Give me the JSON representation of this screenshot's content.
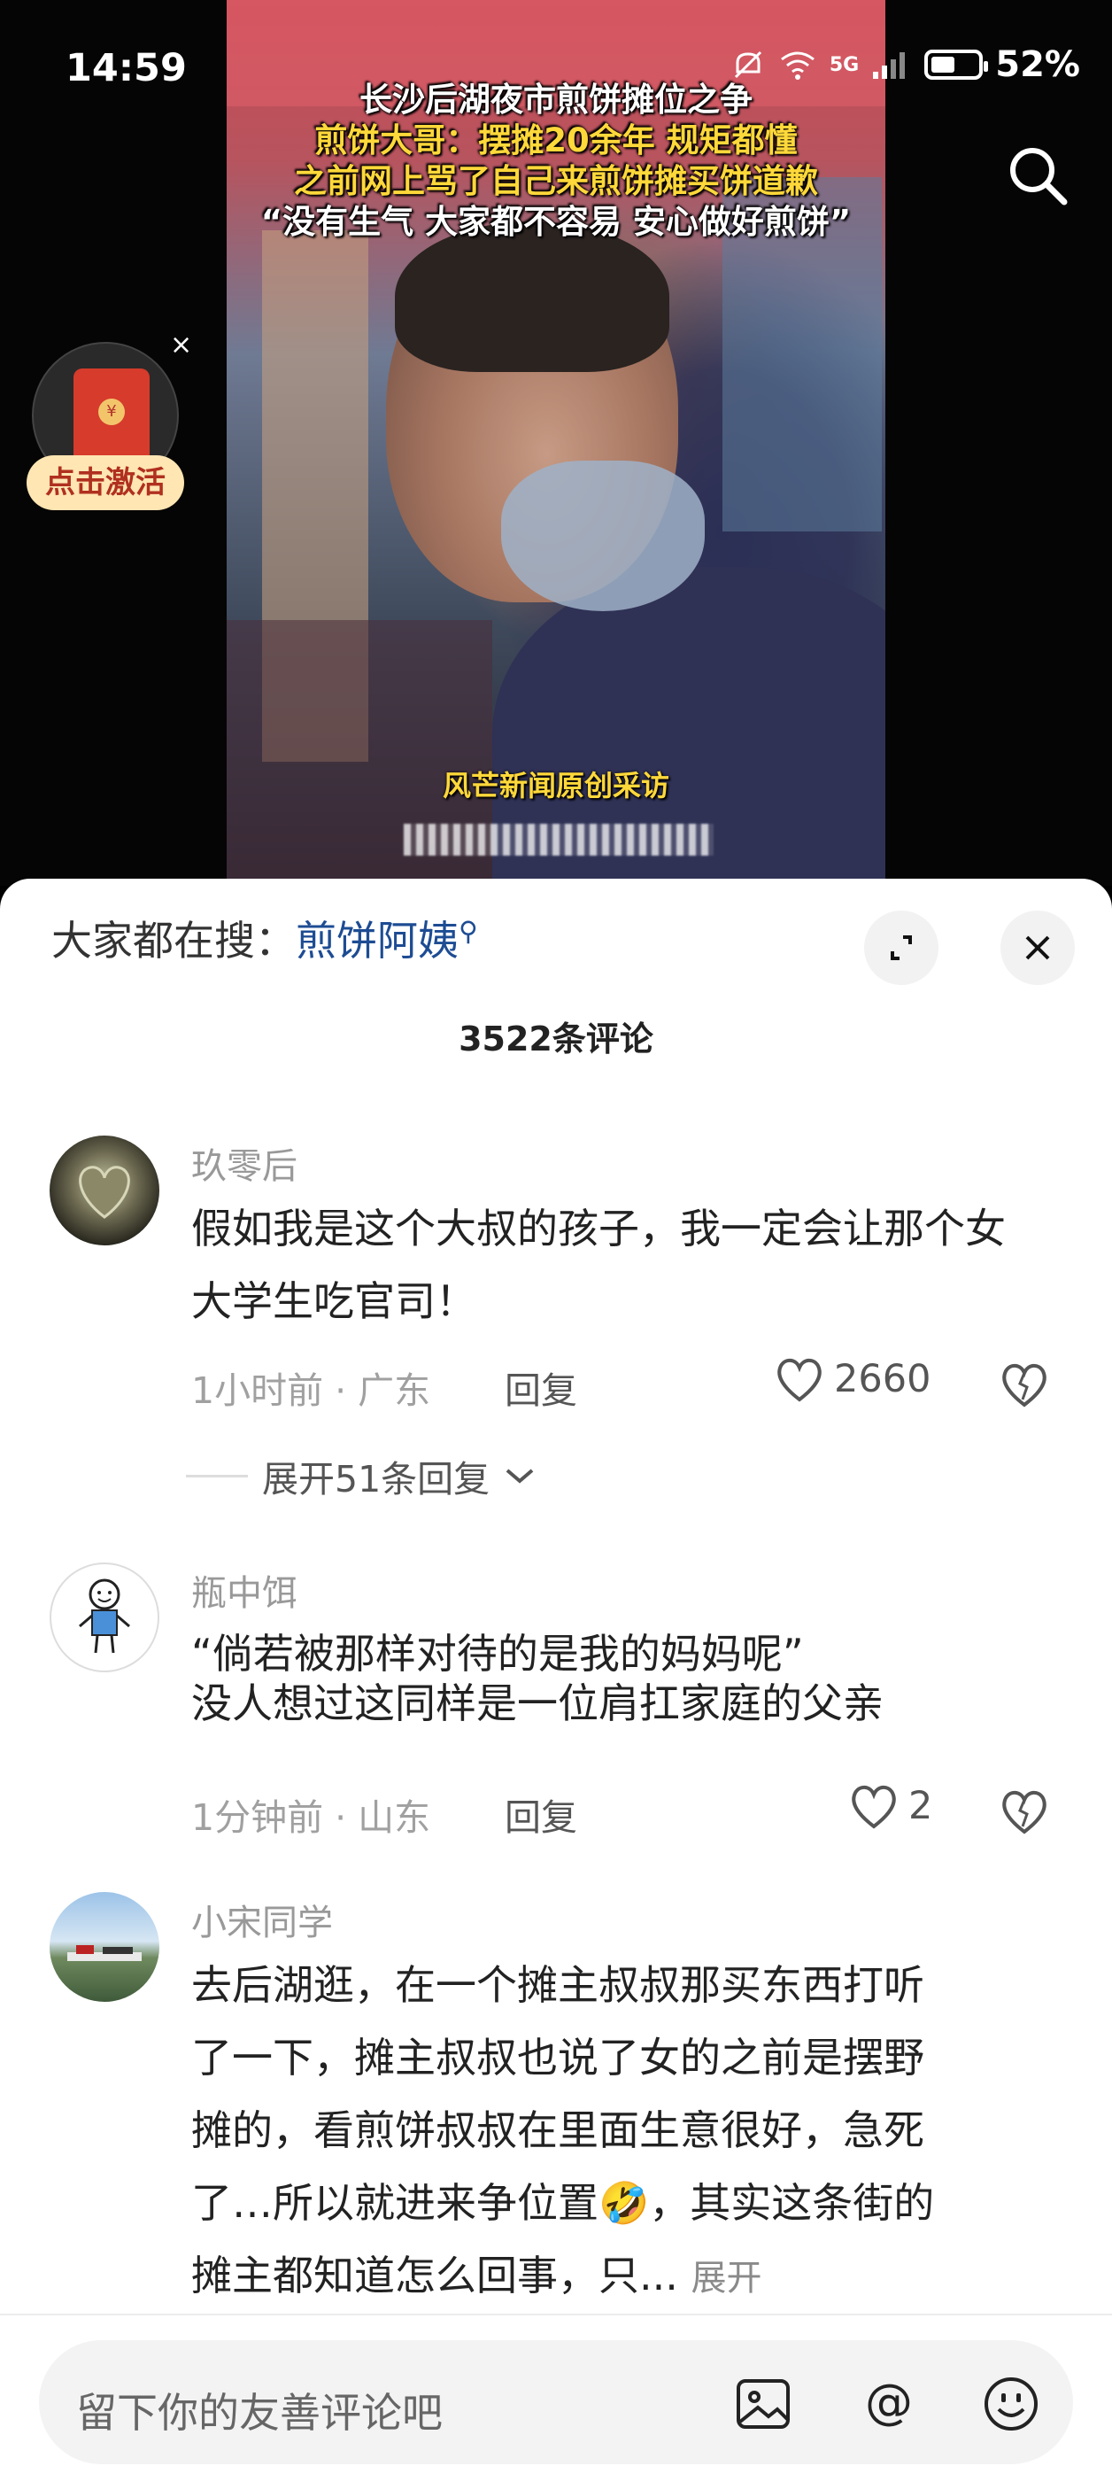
{
  "status_bar": {
    "time": "14:59",
    "network": "5G",
    "battery": "52%",
    "battery_level": 0.52
  },
  "video": {
    "caption_lines": [
      "长沙后湖夜市煎饼摊位之争",
      "煎饼大哥：摆摊20余年 规矩都懂",
      "之前网上骂了自己来煎饼摊买饼道歉",
      "“没有生气 大家都不容易 安心做好煎饼”"
    ],
    "source_credit": "风芒新闻原创采访"
  },
  "promo": {
    "label": "点击激活",
    "close": "×"
  },
  "sheet": {
    "hot_search_prefix": "大家都在搜：",
    "hot_search_keyword": "煎饼阿姨",
    "comment_count": "3522条评论"
  },
  "comments": [
    {
      "author": "玖零后",
      "text": "假如我是这个大叔的孩子，我一定会让那个女大学生吃官司！",
      "meta": "1小时前 · 广东",
      "reply": "回复",
      "likes": "2660",
      "expand_replies": "展开51条回复"
    },
    {
      "author": "瓶中饵",
      "text_line1": "“倘若被那样对待的是我的妈妈呢”",
      "text_line2": "没人想过这同样是一位肩扛家庭的父亲",
      "meta": "1分钟前 · 山东",
      "reply": "回复",
      "likes": "2"
    },
    {
      "author": "小宋同学",
      "text_line1": "去后湖逛，在一个摊主叔叔那买东西打听",
      "text_line2": "了一下，摊主叔叔也说了女的之前是摆野",
      "text_line3": "摊的，看煎饼叔叔在里面生意很好，急死",
      "text_line4a": "了…所以就进来争位置",
      "emoji": "🤣",
      "text_line4b": "，其实这条街的",
      "text_line5": "摊主都知道怎么回事，只...",
      "expand": "展开"
    }
  ],
  "input": {
    "placeholder": "留下你的友善评论吧"
  }
}
